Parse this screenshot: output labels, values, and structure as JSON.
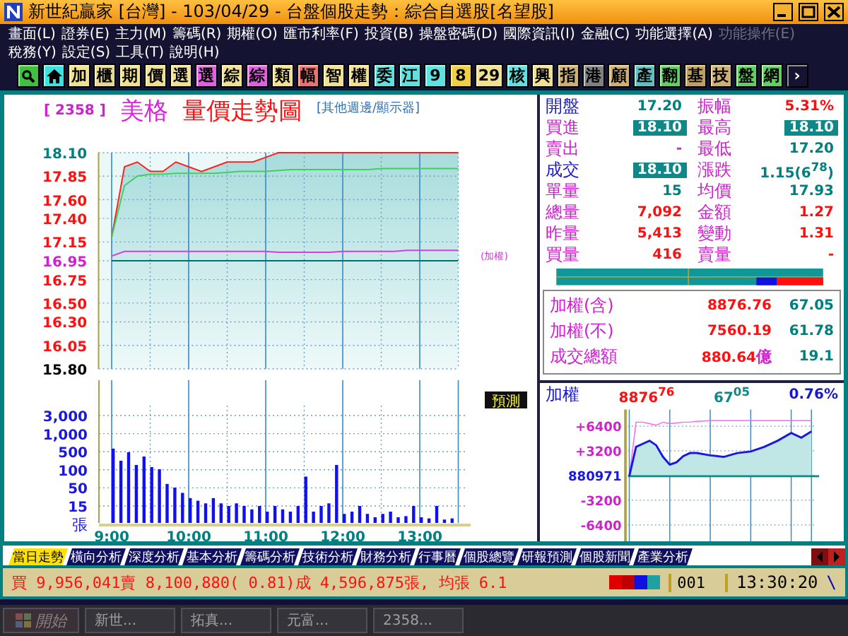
{
  "window": {
    "title": "新世紀贏家 [台灣]  - 103/04/29 - 台盤個股走勢：綜合自選股[名望股]"
  },
  "menu": [
    [
      {
        "label": "畫面(L)",
        "disabled": false
      },
      {
        "label": "證券(E)",
        "disabled": false
      },
      {
        "label": "主力(M)",
        "disabled": false
      },
      {
        "label": "籌碼(R)",
        "disabled": false
      },
      {
        "label": "期權(O)",
        "disabled": false
      },
      {
        "label": "匯市利率(F)",
        "disabled": false
      },
      {
        "label": "投資(B)",
        "disabled": false
      },
      {
        "label": "操盤密碼(D)",
        "disabled": false
      },
      {
        "label": "國際資訊(I)",
        "disabled": false
      },
      {
        "label": "金融(C)",
        "disabled": false
      },
      {
        "label": "功能選擇(A)",
        "disabled": false
      },
      {
        "label": "功能操作(E)",
        "disabled": true
      }
    ],
    [
      {
        "label": "稅務(Y)",
        "disabled": false
      },
      {
        "label": "設定(S)",
        "disabled": false
      },
      {
        "label": "工具(T)",
        "disabled": false
      },
      {
        "label": "說明(H)",
        "disabled": false
      }
    ]
  ],
  "toolbar": [
    {
      "kind": "search",
      "color": "#40c040"
    },
    {
      "kind": "home",
      "color": "#40e0e0"
    },
    {
      "kind": "text",
      "label": "加",
      "color": "#f0e090"
    },
    {
      "kind": "text",
      "label": "櫃",
      "color": "#e8d890"
    },
    {
      "kind": "text",
      "label": "期",
      "color": "#f0e090"
    },
    {
      "kind": "text",
      "label": "價",
      "color": "#f0e090"
    },
    {
      "kind": "text",
      "label": "選",
      "color": "#f0e090"
    },
    {
      "kind": "text",
      "label": "選",
      "color": "#e060e0"
    },
    {
      "kind": "text",
      "label": "綜",
      "color": "#f0e090"
    },
    {
      "kind": "text",
      "label": "綜",
      "color": "#e060e0"
    },
    {
      "kind": "text",
      "label": "類",
      "color": "#f0e090"
    },
    {
      "kind": "text",
      "label": "幅",
      "color": "#f07070"
    },
    {
      "kind": "text",
      "label": "智",
      "color": "#f0e090"
    },
    {
      "kind": "text",
      "label": "權",
      "color": "#f0e090"
    },
    {
      "kind": "text",
      "label": "委",
      "color": "#60e0e0"
    },
    {
      "kind": "text",
      "label": "江",
      "color": "#60e0e0"
    },
    {
      "kind": "text",
      "label": "9",
      "color": "#60e0e0"
    },
    {
      "kind": "text",
      "label": "8",
      "color": "#f0d040"
    },
    {
      "kind": "text",
      "label": "29",
      "color": "#f0e090"
    },
    {
      "kind": "text",
      "label": "核",
      "color": "#60e0e0"
    },
    {
      "kind": "text",
      "label": "興",
      "color": "#f0e090"
    },
    {
      "kind": "text",
      "label": "指",
      "color": "#d0b070"
    },
    {
      "kind": "text",
      "label": "港",
      "color": "#808080"
    },
    {
      "kind": "text",
      "label": "顧",
      "color": "#d0b070"
    },
    {
      "kind": "text",
      "label": "產",
      "color": "#60c0c0"
    },
    {
      "kind": "text",
      "label": "翻",
      "color": "#60d060"
    },
    {
      "kind": "text",
      "label": "基",
      "color": "#c0a060"
    },
    {
      "kind": "text",
      "label": "技",
      "color": "#d0b070"
    },
    {
      "kind": "text",
      "label": "盤",
      "color": "#60d060"
    },
    {
      "kind": "text",
      "label": "網",
      "color": "#60d060"
    },
    {
      "kind": "arrow",
      "label": "›",
      "color": "#141432"
    }
  ],
  "chart_header": {
    "code": "[ 2358 ]",
    "name": "美格",
    "title": "量價走勢圖",
    "category": "[其他週邊/顯示器]"
  },
  "price_chart": {
    "chart_data": {
      "type": "line",
      "ylim": [
        15.8,
        18.1
      ],
      "grid": true,
      "series": [
        {
          "color": "#ff2020",
          "values": [
            17.2,
            17.95,
            18.0,
            17.9,
            17.9,
            18.0,
            17.95,
            17.9,
            17.95,
            18.0,
            18.0,
            18.0,
            18.05,
            18.1,
            18.1,
            18.1,
            18.1,
            18.1,
            18.1,
            18.1,
            18.1,
            18.1,
            18.1,
            18.1,
            18.1,
            18.1,
            18.1,
            18.1
          ]
        },
        {
          "color": "#40d060",
          "values": [
            17.2,
            17.75,
            17.85,
            17.87,
            17.87,
            17.88,
            17.88,
            17.88,
            17.88,
            17.89,
            17.9,
            17.9,
            17.9,
            17.91,
            17.92,
            17.92,
            17.92,
            17.92,
            17.92,
            17.92,
            17.92,
            17.93,
            17.93,
            17.93,
            17.93,
            17.93,
            17.93,
            17.93
          ]
        },
        {
          "color": "#007070",
          "values": [
            16.95,
            16.95,
            16.95,
            16.95,
            16.95,
            16.95,
            16.95,
            16.95,
            16.95,
            16.95,
            16.95,
            16.95,
            16.95,
            16.95,
            16.95,
            16.95,
            16.95,
            16.95,
            16.95,
            16.95,
            16.95,
            16.95,
            16.95,
            16.95,
            16.95,
            16.95,
            16.95,
            16.95
          ]
        },
        {
          "name": "(加權)",
          "color": "#d040e0",
          "values": [
            17.0,
            17.05,
            17.05,
            17.05,
            17.05,
            17.05,
            17.05,
            17.05,
            17.05,
            17.05,
            17.05,
            17.05,
            17.05,
            17.04,
            17.04,
            17.04,
            17.04,
            17.04,
            17.05,
            17.05,
            17.05,
            17.05,
            17.05,
            17.06,
            17.06,
            17.06,
            17.06,
            17.06
          ]
        }
      ],
      "yticks": [
        {
          "value": 18.1,
          "label": "18.10"
        },
        {
          "value": 17.85,
          "label": "17.85"
        },
        {
          "value": 17.6,
          "label": "17.60"
        },
        {
          "value": 17.4,
          "label": "17.40"
        },
        {
          "value": 17.15,
          "label": "17.15"
        },
        {
          "value": 16.95,
          "label": "16.95"
        },
        {
          "value": 16.75,
          "label": "16.75"
        },
        {
          "value": 16.5,
          "label": "16.50"
        },
        {
          "value": 16.3,
          "label": "16.30"
        },
        {
          "value": 16.05,
          "label": "16.05"
        },
        {
          "value": 15.8,
          "label": "15.80"
        }
      ]
    }
  },
  "volume_chart": {
    "forecast_button": "預測",
    "y_labels": [
      "3,000",
      "1,000",
      "500",
      "100",
      "50",
      "15"
    ],
    "unit": "張",
    "time_labels": [
      "9:00",
      "10:00",
      "11:00",
      "12:00",
      "13:00"
    ]
  },
  "quote": [
    {
      "name": {
        "text": "開盤",
        "color": "#1818d0"
      },
      "value": {
        "text": "17.20",
        "color": "#008080",
        "boxed": false
      }
    },
    {
      "name": {
        "text": "振幅",
        "color": "#d020d0"
      },
      "value": {
        "text": "5.31%",
        "color": "#ff1010",
        "boxed": false
      }
    },
    {
      "name": {
        "text": "買進",
        "color": "#d020d0"
      },
      "value": {
        "text": "18.10",
        "boxed": true
      }
    },
    {
      "name": {
        "text": "最高",
        "color": "#d020d0"
      },
      "value": {
        "text": "18.10",
        "boxed": true
      }
    },
    {
      "name": {
        "text": "賣出",
        "color": "#d020d0"
      },
      "value": {
        "text": "-",
        "color": "#d020d0",
        "boxed": false
      }
    },
    {
      "name": {
        "text": "最低",
        "color": "#d020d0"
      },
      "value": {
        "text": "17.20",
        "color": "#008080",
        "boxed": false
      }
    },
    {
      "name": {
        "text": "成交",
        "color": "#1818d0"
      },
      "value": {
        "text": "18.10",
        "boxed": true
      }
    },
    {
      "name": {
        "text": "漲跌",
        "color": "#d020d0"
      },
      "value": {
        "text": "1.15(6$^{78}$)",
        "color": "#008080",
        "boxed": false
      }
    },
    {
      "name": {
        "text": "單量",
        "color": "#d020d0"
      },
      "value": {
        "text": "15",
        "color": "#008080",
        "boxed": false
      }
    },
    {
      "name": {
        "text": "均價",
        "color": "#d020d0"
      },
      "value": {
        "text": "17.93",
        "color": "#008080",
        "boxed": false
      }
    },
    {
      "name": {
        "text": "總量",
        "color": "#d020d0"
      },
      "value": {
        "text": "7,092",
        "color": "#ff1010",
        "boxed": false
      }
    },
    {
      "name": {
        "text": "金額",
        "color": "#d020d0"
      },
      "value": {
        "text": "1.27",
        "color": "#ff1010",
        "boxed": false
      }
    },
    {
      "name": {
        "text": "昨量",
        "color": "#d020d0"
      },
      "value": {
        "text": "5,413",
        "color": "#ff1010",
        "boxed": false
      }
    },
    {
      "name": {
        "text": "變動",
        "color": "#d020d0"
      },
      "value": {
        "text": "1.31",
        "color": "#ff1010",
        "boxed": false
      }
    },
    {
      "name": {
        "text": "買量",
        "color": "#d020d0"
      },
      "value": {
        "text": "416",
        "color": "#ff1010",
        "boxed": false
      }
    },
    {
      "name": {
        "text": "賣量",
        "color": "#d020d0"
      },
      "value": {
        "text": "-",
        "color": "#ff1010",
        "boxed": false
      }
    }
  ],
  "market_summary": [
    {
      "label": "加權(含)",
      "value": "8876.76",
      "change": "67.05"
    },
    {
      "label": "加權(不)",
      "value": "7560.19",
      "change": "61.78"
    },
    {
      "label": "成交總額",
      "value": "880.64",
      "unit": "億",
      "change": "19.1"
    }
  ],
  "index_chart": {
    "label": "加權",
    "value": "8876$^{76}$",
    "change": "67$^{05}$",
    "percent": "0.76%",
    "y_labels": [
      "+6400",
      "+3200",
      "880971",
      "-3200",
      "-6400"
    ]
  },
  "tabs": [
    {
      "label": "當日走勢",
      "selected": true
    },
    {
      "label": "橫向分析",
      "selected": false
    },
    {
      "label": "深度分析",
      "selected": false
    },
    {
      "label": "基本分析",
      "selected": false
    },
    {
      "label": "籌碼分析",
      "selected": false
    },
    {
      "label": "技術分析",
      "selected": false
    },
    {
      "label": "財務分析",
      "selected": false
    },
    {
      "label": "行事曆",
      "selected": false
    },
    {
      "label": "個股總覽",
      "selected": false
    },
    {
      "label": "研報預測",
      "selected": false
    },
    {
      "label": "個股新聞",
      "selected": false
    },
    {
      "label": "產業分析",
      "selected": false
    }
  ],
  "status_bar": {
    "summary": "買 9,956,041賣 8,100,880( 0.81)成 4,596,875張, 均張 6.1",
    "page": "001",
    "time": "13:30:20",
    "end_mark": "\\"
  },
  "taskbar": {
    "start": "開始",
    "tasks": [
      "新世...",
      "拓真...",
      "元富...",
      "2358..."
    ]
  }
}
